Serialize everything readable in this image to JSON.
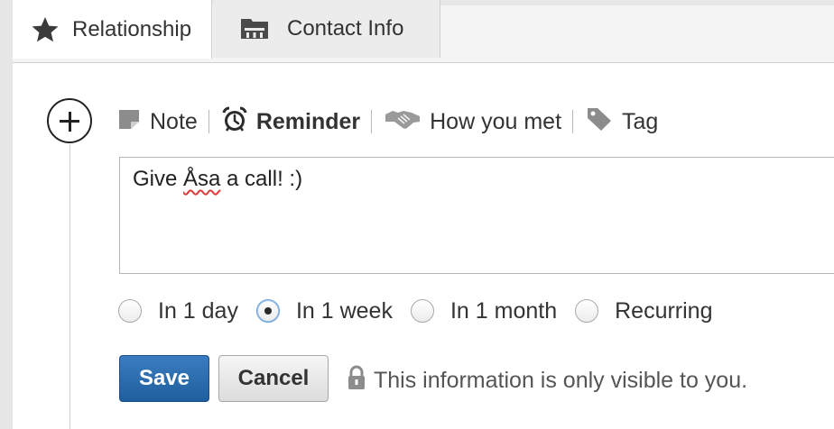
{
  "tabs": [
    {
      "label": "Relationship",
      "icon": "star-icon",
      "active": true
    },
    {
      "label": "Contact Info",
      "icon": "folder-card-icon",
      "active": false
    }
  ],
  "add_button": {
    "icon": "plus-circle-icon"
  },
  "actions": [
    {
      "label": "Note",
      "icon": "note-icon",
      "bold": false
    },
    {
      "label": "Reminder",
      "icon": "alarm-clock-icon",
      "bold": true
    },
    {
      "label": "How you met",
      "icon": "handshake-icon",
      "bold": false
    },
    {
      "label": "Tag",
      "icon": "tag-icon",
      "bold": false
    }
  ],
  "note": {
    "pre": "Give ",
    "misspelled": "Åsa",
    "post": " a call! :)"
  },
  "radios": [
    {
      "label": "In 1 day",
      "checked": false
    },
    {
      "label": "In 1 week",
      "checked": true
    },
    {
      "label": "In 1 month",
      "checked": false
    },
    {
      "label": "Recurring",
      "checked": false
    }
  ],
  "buttons": {
    "save": "Save",
    "cancel": "Cancel"
  },
  "privacy": {
    "text": "This information is only visible to you.",
    "icon": "lock-icon"
  },
  "colors": {
    "primary": "#2a6cb0",
    "text": "#333333",
    "border": "#b5b5b5"
  }
}
